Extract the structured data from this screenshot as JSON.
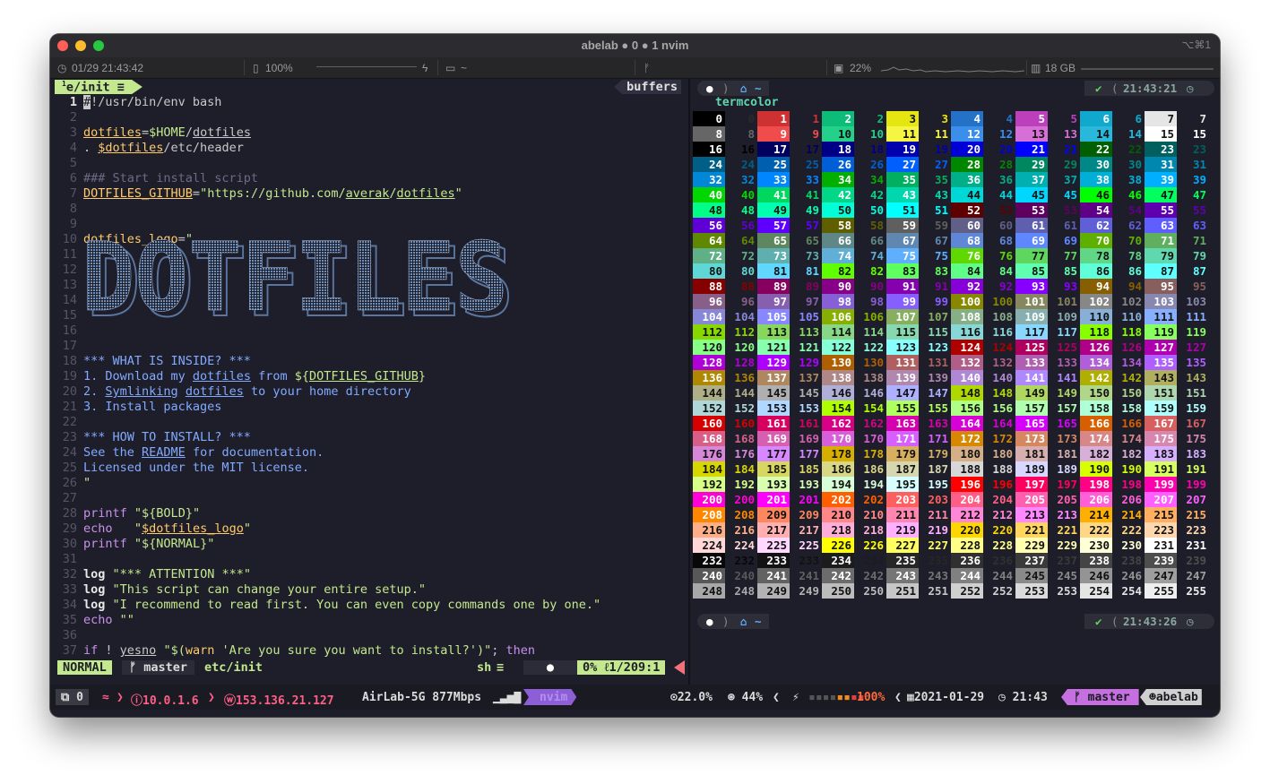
{
  "window": {
    "title": "abelab ● 0 ● 1 nvim",
    "shortcut": "⌥⌘1",
    "traffic_lights": {
      "close": "#fe5f57",
      "minimize": "#febc2e",
      "zoom": "#28c840"
    }
  },
  "topbar": {
    "datetime": "01/29 21:43:42",
    "battery": "100%",
    "folder": "~",
    "cpu": "22%",
    "memory": "18 GB",
    "icons": [
      "clock-icon",
      "battery-icon",
      "lightning-icon",
      "folder-icon",
      "git-branch-icon",
      "cpu-icon",
      "memory-icon"
    ]
  },
  "editor": {
    "tab_number": "1",
    "tab_label": "e/init",
    "buffers_label": "buffers",
    "lines": [
      {
        "n": "1",
        "html": "<span style='background:#c9c9c9;color:#1e1e2a'>#</span>!/usr/bin/env bash"
      },
      {
        "n": "2",
        "html": ""
      },
      {
        "n": "3",
        "html": "<span class='y u'>dotfiles</span>=<span class='g'>$HOME</span>/<span class='u'>dotfiles</span>"
      },
      {
        "n": "4",
        "html": ". <span class='y u'>$dotfiles</span>/etc/header"
      },
      {
        "n": "5",
        "html": ""
      },
      {
        "n": "6",
        "html": "<span class='c'>### Start install script</span>"
      },
      {
        "n": "7",
        "html": "<span class='y u'>DOTFILES_GITHUB</span>=<span class='g'>\"https://github.com/<span class='u'>averak</span>/<span class='u'>dotfiles</span>\"</span>"
      },
      {
        "n": "8",
        "html": ""
      },
      {
        "n": "9",
        "html": ""
      },
      {
        "n": "10",
        "html": "<span class='y'>dotfiles_logo</span>=<span class='g'>\"</span>"
      },
      {
        "n": "11",
        "html": ""
      },
      {
        "n": "12",
        "html": ""
      },
      {
        "n": "13",
        "html": ""
      },
      {
        "n": "14",
        "html": ""
      },
      {
        "n": "15",
        "html": ""
      },
      {
        "n": "16",
        "html": ""
      },
      {
        "n": "17",
        "html": ""
      },
      {
        "n": "18",
        "html": "<span class='bl'>*** WHAT IS INSIDE? ***</span>"
      },
      {
        "n": "19",
        "html": "<span class='bl'>1. Download my <span class='u'>dotfiles</span> from </span><span class='g'>${<span class='u'>DOTFILES_GITHUB</span>}</span>"
      },
      {
        "n": "20",
        "html": "<span class='bl'>2. <span class='u'>Symlinking</span> <span class='u'>dotfiles</span> to your home directory</span>"
      },
      {
        "n": "21",
        "html": "<span class='bl'>3. Install packages</span>"
      },
      {
        "n": "22",
        "html": ""
      },
      {
        "n": "23",
        "html": "<span class='bl'>*** HOW TO INSTALL? ***</span>"
      },
      {
        "n": "24",
        "html": "<span class='bl'>See the <span class='u'>README</span> for documentation.</span>"
      },
      {
        "n": "25",
        "html": "<span class='bl'>Licensed under the MIT license.</span>"
      },
      {
        "n": "26",
        "html": "<span class='g'>\"</span>"
      },
      {
        "n": "27",
        "html": ""
      },
      {
        "n": "28",
        "html": "<span class='m'>printf</span> <span class='g'>\"${BOLD}\"</span>"
      },
      {
        "n": "29",
        "html": "<span class='m'>echo</span>   <span class='g'>\"<span class='y u'>$dotfiles_logo</span>\"</span>"
      },
      {
        "n": "30",
        "html": "<span class='m'>printf</span> <span class='g'>\"${NORMAL}\"</span>"
      },
      {
        "n": "31",
        "html": ""
      },
      {
        "n": "32",
        "html": "<span class='w'>log</span> <span class='g'>\"*** ATTENTION ***\"</span>"
      },
      {
        "n": "33",
        "html": "<span class='w'>log</span> <span class='g'>\"This script can change your entire setup.\"</span>"
      },
      {
        "n": "34",
        "html": "<span class='w'>log</span> <span class='g'>\"I recommend to read first. You can even copy commands one by one.\"</span>"
      },
      {
        "n": "35",
        "html": "<span class='m'>echo</span> <span class='g'>\"\"</span>"
      },
      {
        "n": "36",
        "html": ""
      },
      {
        "n": "37",
        "html": "<span class='m'>if</span> ! <span class='u'>yesno</span> <span class='g'>\"$(<span class='y'>warn</span> 'Are you sure you want to install?')\"</span>; <span class='m'>then</span>"
      }
    ],
    "logo_text": "DOTFILES",
    "mode": "NORMAL",
    "branch": "master",
    "file": "etc/init",
    "filetype": "sh",
    "position": "0% ℓ1/209:1"
  },
  "terminal": {
    "prompt_time_1": "21:43:21",
    "prompt_time_2": "21:43:26",
    "command": "termcolor",
    "prompt_dir": "~"
  },
  "tmux": {
    "window_count": "0",
    "local_ip": "10.0.1.6",
    "public_ip": "153.136.21.127",
    "wifi": "AirLab-5G 877Mbps",
    "window_name": "nvim",
    "cpu": "22.0%",
    "mem": "44%",
    "battery": "100%",
    "date": "2021-01-29",
    "time": "21:43",
    "branch": "master",
    "user": "abelab"
  }
}
